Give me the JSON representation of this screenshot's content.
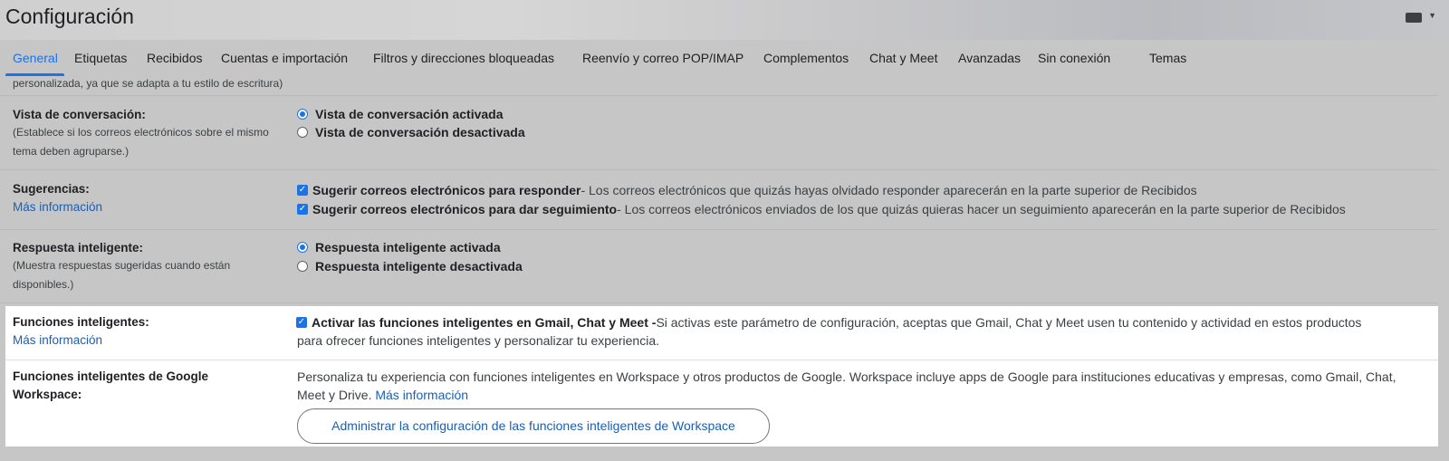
{
  "header": {
    "title": "Configuración"
  },
  "tabs": [
    {
      "label": "General",
      "active": true
    },
    {
      "label": "Etiquetas"
    },
    {
      "label": "Recibidos"
    },
    {
      "label": "Cuentas e importación"
    },
    {
      "label": "Filtros y direcciones bloqueadas"
    },
    {
      "label": "Reenvío y correo POP/IMAP"
    },
    {
      "label": "Complementos"
    },
    {
      "label": "Chat y Meet"
    },
    {
      "label": "Avanzadas"
    },
    {
      "label": "Sin conexión"
    },
    {
      "label": "Temas"
    }
  ],
  "cut_text": "personalizada, ya que se adapta a tu estilo de escritura)",
  "conversation": {
    "label": "Vista de conversación:",
    "desc1": "(Establece si los correos electrónicos sobre el mismo",
    "desc2": "tema deben agruparse.)",
    "opt_on": "Vista de conversación activada",
    "opt_off": "Vista de conversación desactivada"
  },
  "suggestions": {
    "label": "Sugerencias:",
    "link": "Más información",
    "opt1_bold": "Sugerir correos electrónicos para responder",
    "opt1_rest": " - Los correos electrónicos que quizás hayas olvidado responder aparecerán en la parte superior de Recibidos",
    "opt2_bold": "Sugerir correos electrónicos para dar seguimiento",
    "opt2_rest": " - Los correos electrónicos enviados de los que quizás quieras hacer un seguimiento aparecerán en la parte superior de Recibidos"
  },
  "smart_reply": {
    "label": "Respuesta inteligente:",
    "desc1": "(Muestra respuestas sugeridas cuando están",
    "desc2": "disponibles.)",
    "opt_on": "Respuesta inteligente activada",
    "opt_off": "Respuesta inteligente desactivada"
  },
  "smart_features": {
    "label": "Funciones inteligentes:",
    "link": "Más información",
    "check_bold": "Activar las funciones inteligentes en Gmail, Chat y Meet -",
    "line1_rest": " Si activas este parámetro de configuración, aceptas que Gmail, Chat y Meet usen tu contenido y actividad en estos productos",
    "line2": "para ofrecer funciones inteligentes y personalizar tu experiencia."
  },
  "workspace": {
    "label1": "Funciones inteligentes de Google",
    "label2": "Workspace:",
    "line1": "Personaliza tu experiencia con funciones inteligentes en Workspace y otros productos de Google. Workspace incluye apps de Google para instituciones educativas y empresas, como Gmail, Chat,",
    "line2": "Meet y Drive.",
    "link": "Más información",
    "button": "Administrar la configuración de las funciones inteligentes de Workspace"
  }
}
